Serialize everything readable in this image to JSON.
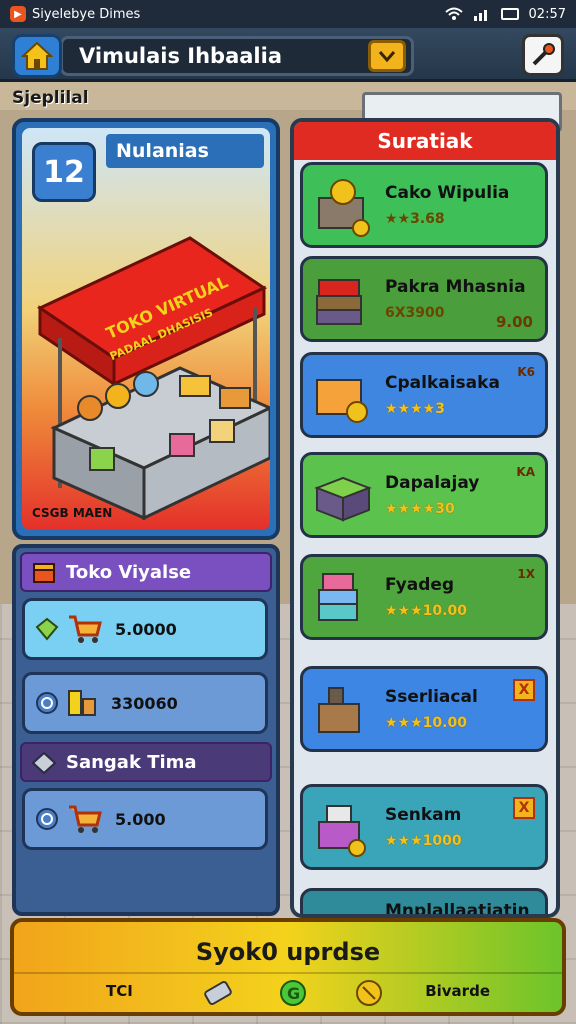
{
  "status_bar": {
    "app_name": "Siyelebye Dimes",
    "time": "02:57",
    "icons": [
      "wifi-icon",
      "signal-icon",
      "battery-icon"
    ]
  },
  "header": {
    "title": "Vimulais Ihbaalia",
    "home_icon": "home-icon",
    "dropdown_icon": "chevron-down-icon",
    "tool_icon": "build-icon"
  },
  "section_label": "Sjeplilal",
  "promo": {
    "badge": "12",
    "heading": "Nulanias",
    "banner_line1": "TOKO VIRTUAL",
    "banner_line2": "PADAAL DHASISIS",
    "footer": "CSGB MAEN"
  },
  "stats": {
    "header": "Toko Viyalse",
    "rows": [
      {
        "value": "5.0000"
      },
      {
        "value": "330060"
      }
    ],
    "sub_header": "Sangak Tima",
    "sub_rows": [
      {
        "value": "5.000"
      }
    ]
  },
  "list": {
    "header": "Suratiak",
    "items": [
      {
        "name": "Cako Wipulia",
        "price": "★★3.68",
        "corner": "",
        "extra": ""
      },
      {
        "name": "Pakra Mhasnia",
        "price": "6X3900",
        "corner": "",
        "extra": "9.00"
      },
      {
        "name": "Cpalkaisaka",
        "price": "★★★★3",
        "corner": "K6",
        "extra": ""
      },
      {
        "name": "Dapalajay",
        "price": "★★★★30",
        "corner": "KA",
        "extra": ""
      },
      {
        "name": "Fyadeg",
        "price": "★★★10.00",
        "corner": "1X",
        "extra": ""
      },
      {
        "name": "Sserliacal",
        "price": "★★★10.00",
        "corner": "X",
        "extra": ""
      },
      {
        "name": "Senkam",
        "price": "★★★1000",
        "corner": "X",
        "extra": ""
      },
      {
        "name": "Mnplallaatiatin",
        "price": "",
        "corner": "",
        "extra": ""
      }
    ]
  },
  "bottom": {
    "label": "Syok0 uprdse",
    "left": "TCI",
    "right": "Bivarde"
  },
  "colors": {
    "list_header": "#e02b23",
    "bottom_start": "#f2a41b",
    "bottom_end": "#6cc42a"
  }
}
